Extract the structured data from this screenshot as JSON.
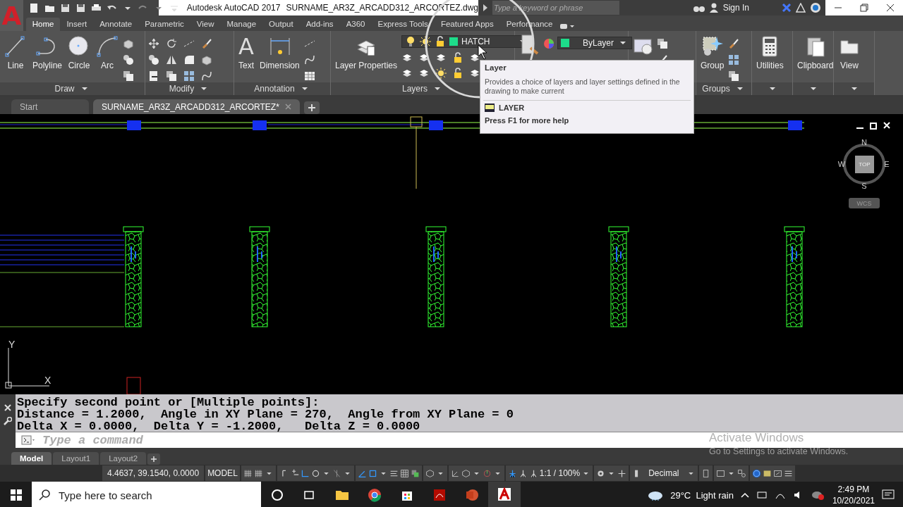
{
  "app_button": {
    "glyph": "A"
  },
  "title_bar": {
    "title": "Autodesk AutoCAD 2017",
    "file": "SURNAME_AR3Z_ARCADD312_ARCORTEZ.dwg",
    "search": {
      "placeholder": "Type a keyword or phrase"
    },
    "sign_in": "Sign In"
  },
  "ribbon_tabs": [
    {
      "label": "Home",
      "selected": true
    },
    {
      "label": "Insert",
      "selected": false
    },
    {
      "label": "Annotate",
      "selected": false
    },
    {
      "label": "Parametric",
      "selected": false
    },
    {
      "label": "View",
      "selected": false
    },
    {
      "label": "Manage",
      "selected": false
    },
    {
      "label": "Output",
      "selected": false
    },
    {
      "label": "Add-ins",
      "selected": false
    },
    {
      "label": "A360",
      "selected": false
    },
    {
      "label": "Express Tools",
      "selected": false
    },
    {
      "label": "Featured Apps",
      "selected": false
    },
    {
      "label": "Performance",
      "selected": false
    }
  ],
  "panels": [
    {
      "kind": "draw",
      "title": "Draw",
      "tools": [
        {
          "label": "Line"
        },
        {
          "label": "Polyline"
        },
        {
          "label": "Circle"
        },
        {
          "label": "Arc"
        }
      ]
    },
    {
      "kind": "modify",
      "title": "Modify"
    },
    {
      "kind": "annotation",
      "title": "Annotation",
      "tools": [
        {
          "label": "Text",
          "glyph": "A"
        },
        {
          "label": "Dimension"
        }
      ]
    },
    {
      "kind": "layers",
      "title": "Layers",
      "tools": [
        {
          "label": "Layer Properties"
        }
      ],
      "layer": "HATCH"
    },
    {
      "kind": "properties",
      "setting": "ByLayer"
    },
    {
      "kind": "block"
    },
    {
      "kind": "groups",
      "title": "Groups",
      "tools": [
        {
          "label": "Group"
        }
      ]
    },
    {
      "kind": "single",
      "tools": [
        {
          "label": "Utilities"
        }
      ]
    },
    {
      "kind": "single",
      "tools": [
        {
          "label": "Clipboard"
        }
      ]
    },
    {
      "kind": "single",
      "tools": [
        {
          "label": "View"
        }
      ]
    }
  ],
  "doc_tabs": [
    {
      "label": "Start",
      "selected": false
    },
    {
      "label": "SURNAME_AR3Z_ARCADD312_ARCORTEZ*",
      "selected": true
    }
  ],
  "viewcube": {
    "north": "N",
    "south": "S",
    "east": "E",
    "west": "W",
    "face": "TOP",
    "ucs": "WCS"
  },
  "ucs_icon": {
    "x": "X",
    "y": "Y"
  },
  "command": {
    "history": [
      "Specify second point or [Multiple points]:",
      "Distance = 1.2000,  Angle in XY Plane = 270,  Angle from XY Plane = 0",
      "Delta X = 0.0000,  Delta Y = -1.2000,   Delta Z = 0.0000"
    ],
    "placeholder": "Type a command"
  },
  "layout_tabs": [
    {
      "label": "Model",
      "selected": true
    },
    {
      "label": "Layout1",
      "selected": false
    },
    {
      "label": "Layout2",
      "selected": false
    }
  ],
  "status_bar": {
    "coordinates": "4.4637, 39.1540, 0.0000",
    "space": "MODEL",
    "scale": "1:1 / 100%",
    "units": "Decimal"
  },
  "tooltip": {
    "title": "Layer",
    "description": "Provides a choice of layers and layer settings defined in the drawing to make current",
    "command": "LAYER",
    "help": "Press F1 for more help"
  },
  "activation": {
    "title": "Activate Windows",
    "message": "Go to Settings to activate Windows."
  },
  "taskbar": {
    "search": {
      "placeholder": "Type here to search"
    },
    "weather": "29°C  Light rain",
    "time": "2:49 PM",
    "date": "10/20/2021"
  }
}
